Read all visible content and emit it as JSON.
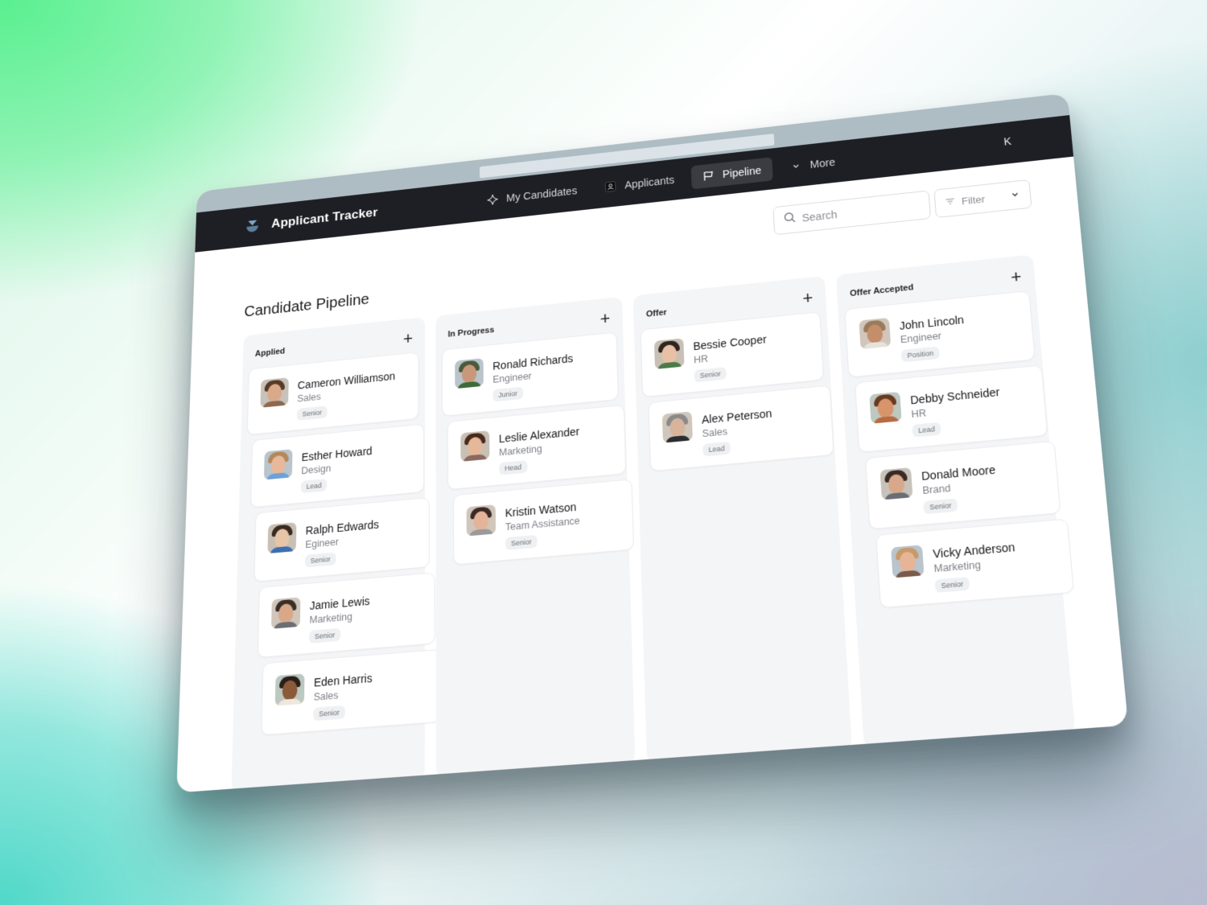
{
  "app": {
    "title": "Applicant Tracker",
    "user_initial": "K"
  },
  "nav": {
    "items": [
      {
        "label": "My Candidates",
        "icon": "sparkle-icon",
        "active": false
      },
      {
        "label": "Applicants",
        "icon": "person-badge-icon",
        "active": false
      },
      {
        "label": "Pipeline",
        "icon": "flag-icon",
        "active": true
      },
      {
        "label": "More",
        "icon": "chevron-down-icon",
        "active": false
      }
    ]
  },
  "toolbar": {
    "search_placeholder": "Search",
    "search_value": "",
    "filter_label": "Filter"
  },
  "page": {
    "title": "Candidate Pipeline"
  },
  "columns": [
    {
      "title": "Applied",
      "cards": [
        {
          "name": "Cameron Williamson",
          "role": "Sales",
          "tag": "Senior",
          "skin": "#d9a989",
          "hair": "#5a3a25",
          "shirt": "#8b6a50"
        },
        {
          "name": "Esther Howard",
          "role": "Design",
          "tag": "Lead",
          "skin": "#e8b89a",
          "hair": "#b5885a",
          "shirt": "#6ea0d6"
        },
        {
          "name": "Ralph Edwards",
          "role": "Egineer",
          "tag": "Senior",
          "skin": "#e8c4a8",
          "hair": "#3a2a20",
          "shirt": "#3d6fb0"
        },
        {
          "name": "Jamie Lewis",
          "role": "Marketing",
          "tag": "Senior",
          "skin": "#d8a888",
          "hair": "#3a2e28",
          "shirt": "#6b6f74"
        },
        {
          "name": "Eden Harris",
          "role": "Sales",
          "tag": "Senior",
          "skin": "#8a5a3a",
          "hair": "#2a1e18",
          "shirt": "#f0e6dc"
        }
      ]
    },
    {
      "title": "In Progress",
      "cards": [
        {
          "name": "Ronald Richards",
          "role": "Engineer",
          "tag": "Junior",
          "skin": "#c9987a",
          "hair": "#4b5a3a",
          "shirt": "#3f6a3a"
        },
        {
          "name": "Leslie Alexander",
          "role": "Marketing",
          "tag": "Head",
          "skin": "#e6b89a",
          "hair": "#4a2a1c",
          "shirt": "#8a6a60"
        },
        {
          "name": "Kristin Watson",
          "role": "Team Assistance",
          "tag": "Senior",
          "skin": "#e4b49a",
          "hair": "#3a2a22",
          "shirt": "#9a9a9a"
        }
      ]
    },
    {
      "title": "Offer",
      "cards": [
        {
          "name": "Bessie Cooper",
          "role": "HR",
          "tag": "Senior",
          "skin": "#e8c0a6",
          "hair": "#2e2420",
          "shirt": "#4c7a4a"
        },
        {
          "name": "Alex Peterson",
          "role": "Sales",
          "tag": "Lead",
          "skin": "#d8b49c",
          "hair": "#8a8a8a",
          "shirt": "#2a2c30"
        }
      ]
    },
    {
      "title": "Offer Accepted",
      "cards": [
        {
          "name": "John Lincoln",
          "role": "Engineer",
          "tag": "Position",
          "skin": "#c48e6a",
          "hair": "#9a7a5a",
          "shirt": "#e6e2dc"
        },
        {
          "name": "Debby Schneider",
          "role": "HR",
          "tag": "Lead",
          "skin": "#d8946a",
          "hair": "#6a3a20",
          "shirt": "#b86a40"
        },
        {
          "name": "Donald Moore",
          "role": "Brand",
          "tag": "Senior",
          "skin": "#d8a88a",
          "hair": "#3a2a24",
          "shirt": "#6a6e74"
        },
        {
          "name": "Vicky Anderson",
          "role": "Marketing",
          "tag": "Senior",
          "skin": "#e6b496",
          "hair": "#c89a6a",
          "shirt": "#7a5a4a"
        }
      ]
    }
  ]
}
